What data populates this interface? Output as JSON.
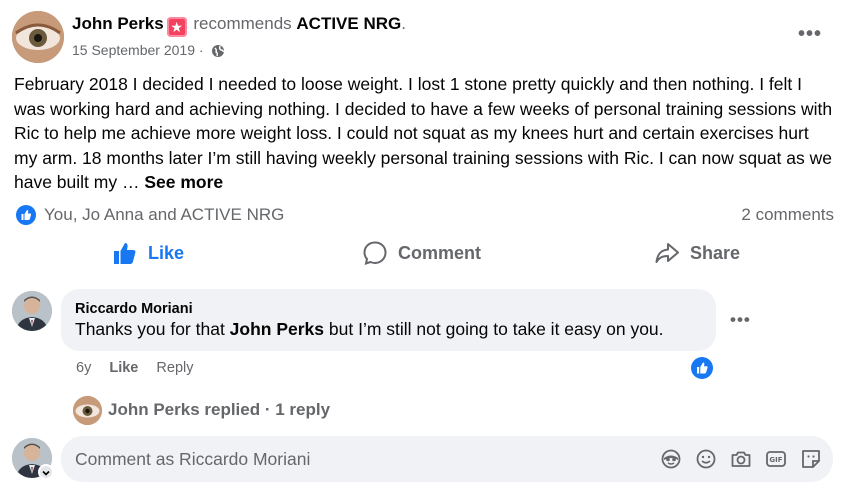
{
  "header": {
    "author": "John Perks",
    "recommends_text": "recommends",
    "page_name": "ACTIVE NRG",
    "period": ".",
    "date": "15 September 2019",
    "separator": "·",
    "more_icon": "more-dots-icon"
  },
  "post": {
    "text": "February 2018 I decided I needed to loose weight. I lost 1 stone pretty quickly and then nothing. I felt I was working hard and achieving nothing. I decided to have a few weeks of personal training sessions with Ric to help me achieve more weight loss.  I could not squat as my knees hurt and certain exercises hurt my arm.  18 months later I’m still having weekly personal training sessions with Ric. I can now squat as we have built my …",
    "see_more": "See more"
  },
  "reactions": {
    "names": "You, Jo Anna and ACTIVE NRG",
    "comment_count": "2 comments"
  },
  "actions": {
    "like": "Like",
    "comment": "Comment",
    "share": "Share"
  },
  "comment": {
    "author": "Riccardo Moriani",
    "text_before": "Thanks you for that ",
    "mention": "John Perks",
    "text_after": " but I’m still not going to take it easy on you.",
    "age": "6y",
    "like": "Like",
    "reply": "Reply"
  },
  "replies": {
    "label": "John Perks replied · 1 reply"
  },
  "composer": {
    "placeholder": "Comment as Riccardo Moriani"
  },
  "colors": {
    "accent": "#1877f2",
    "muted": "#65676b",
    "bubble": "#f0f2f5",
    "badge": "#f3425f"
  }
}
